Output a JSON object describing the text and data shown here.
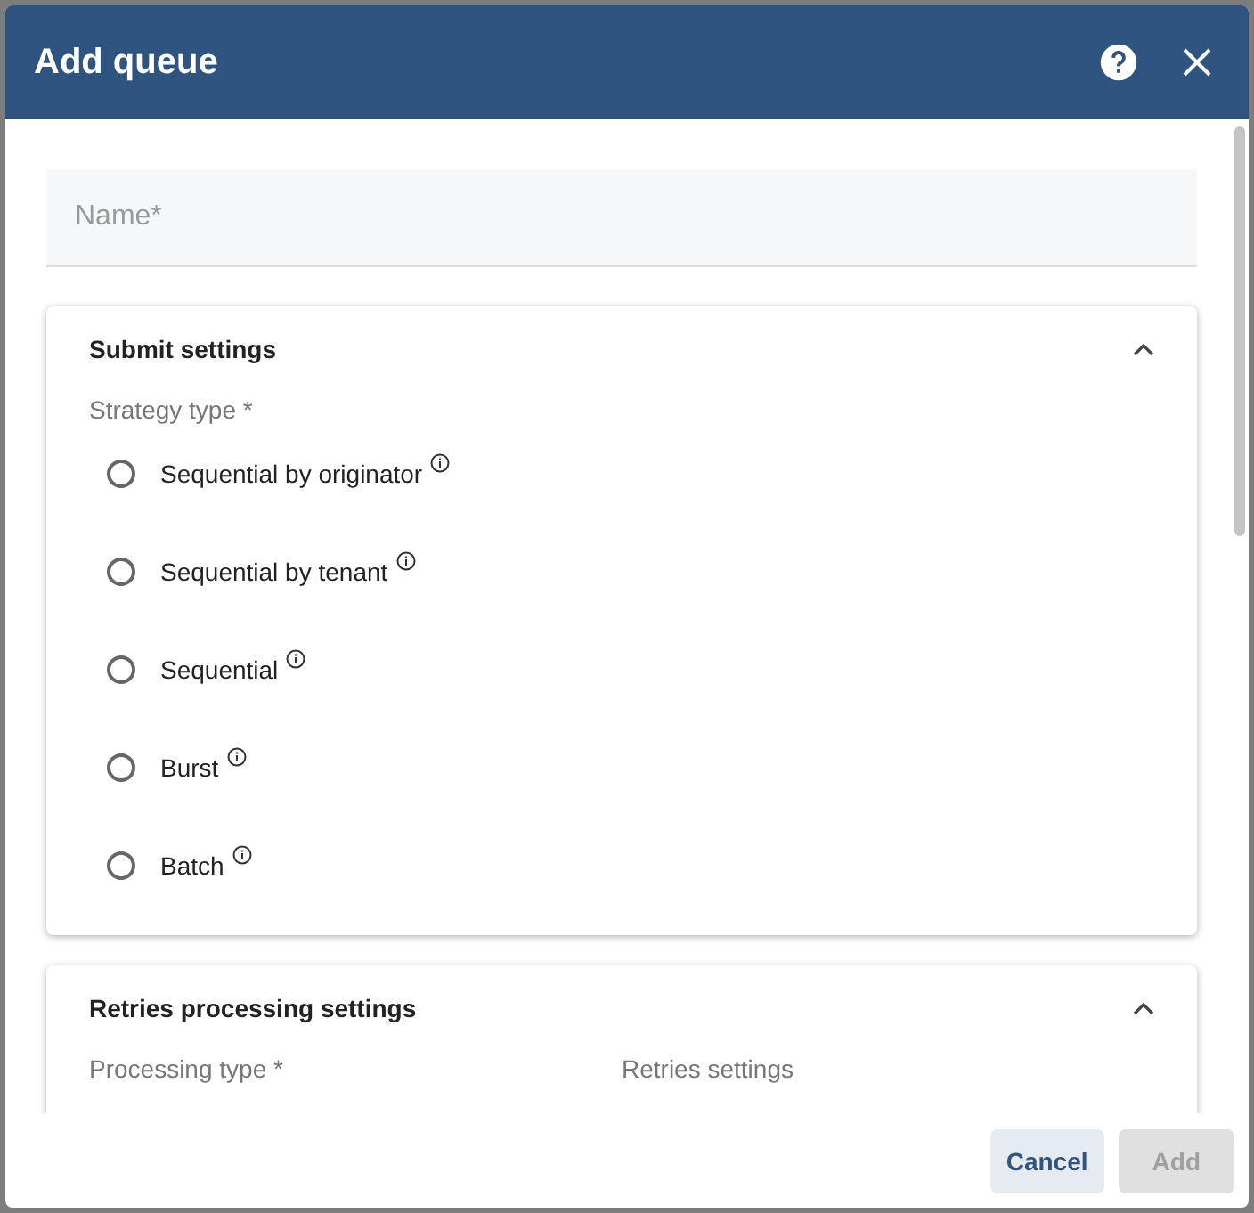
{
  "dialog": {
    "title": "Add queue"
  },
  "name_field": {
    "placeholder": "Name*"
  },
  "sections": [
    {
      "title": "Submit settings",
      "expanded": true,
      "fields": [
        {
          "label": "Strategy type *",
          "options": [
            {
              "label": "Sequential by originator",
              "selected": false
            },
            {
              "label": "Sequential by tenant",
              "selected": false
            },
            {
              "label": "Sequential",
              "selected": false
            },
            {
              "label": "Burst",
              "selected": false
            },
            {
              "label": "Batch",
              "selected": false
            }
          ]
        }
      ]
    },
    {
      "title": "Retries processing settings",
      "expanded": true,
      "fields": [
        {
          "label": "Processing type *"
        },
        {
          "label": "Retries settings"
        }
      ]
    }
  ],
  "buttons": [
    {
      "label": "Cancel",
      "disabled": false
    },
    {
      "label": "Add",
      "disabled": true
    }
  ]
}
